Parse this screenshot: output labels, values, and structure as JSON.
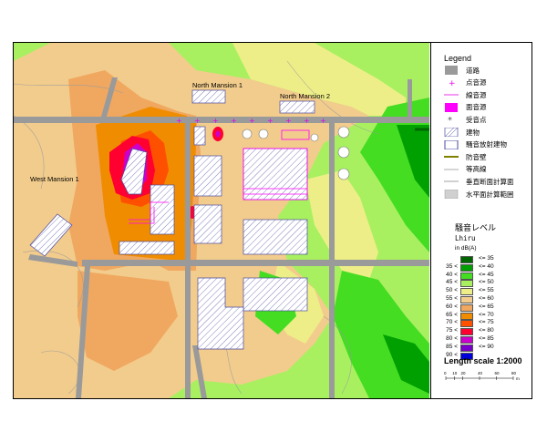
{
  "map": {
    "labels": {
      "north_mansion_1": "North Mansion 1",
      "north_mansion_2": "North Mansion 2",
      "west_mansion_1": "West Mansion 1"
    }
  },
  "legend": {
    "title": "Legend",
    "items": [
      {
        "label": "道路",
        "icon": "road-swatch",
        "color": "#9a9a9a"
      },
      {
        "label": "点音源",
        "icon": "point-source-plus",
        "color": "#e600e6"
      },
      {
        "label": "線音源",
        "icon": "line-source",
        "color": "#e600e6"
      },
      {
        "label": "面音源",
        "icon": "area-source-swatch",
        "color": "#ff00ff"
      },
      {
        "label": "受音点",
        "icon": "receiver-asterisk",
        "color": "#555555"
      },
      {
        "label": "建物",
        "icon": "building-hatch",
        "color": "#4a4aa0"
      },
      {
        "label": "騒音放射建物",
        "icon": "radiating-building",
        "color": "#4a4aa0"
      },
      {
        "label": "防音壁",
        "icon": "noise-barrier-line",
        "color": "#808000"
      },
      {
        "label": "等高線",
        "icon": "contour-line",
        "color": "#999999"
      },
      {
        "label": "垂直断面計算面",
        "icon": "vertical-section-line",
        "color": "#c0c0c0"
      },
      {
        "label": "水平面計算範囲",
        "icon": "horizontal-range-swatch",
        "color": "#d0d0d0"
      }
    ],
    "noise": {
      "title": "騒音レベル",
      "unit": "Lhiru",
      "unit2": "in dB(A)",
      "levels": [
        {
          "low": "",
          "high": "<= 35",
          "color": "#006600"
        },
        {
          "low": "35 <",
          "high": "<= 40",
          "color": "#00a000"
        },
        {
          "low": "40 <",
          "high": "<= 45",
          "color": "#44dd22"
        },
        {
          "low": "45 <",
          "high": "<= 50",
          "color": "#a8f060"
        },
        {
          "low": "50 <",
          "high": "<= 55",
          "color": "#eeee88"
        },
        {
          "low": "55 <",
          "high": "<= 60",
          "color": "#f2cc8c"
        },
        {
          "low": "60 <",
          "high": "<= 65",
          "color": "#f0a860"
        },
        {
          "low": "65 <",
          "high": "<= 70",
          "color": "#f08c00"
        },
        {
          "low": "70 <",
          "high": "<= 75",
          "color": "#ff5000"
        },
        {
          "low": "75 <",
          "high": "<= 80",
          "color": "#ff0030"
        },
        {
          "low": "80 <",
          "high": "<= 85",
          "color": "#cc00cc"
        },
        {
          "low": "85 <",
          "high": "<= 90",
          "color": "#7700cc"
        },
        {
          "low": "90 <",
          "high": "",
          "color": "#0000dd"
        }
      ]
    },
    "length_scale": {
      "title": "Length scale 1:2000",
      "ticks": [
        "0",
        "10",
        "20",
        "40",
        "60",
        "80"
      ],
      "unit": "m"
    }
  }
}
